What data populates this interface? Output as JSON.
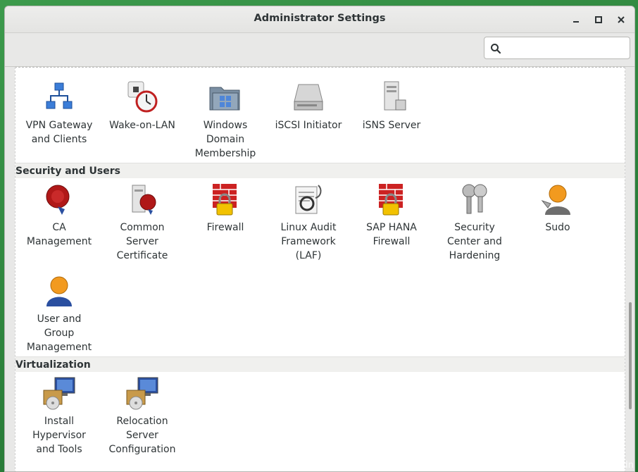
{
  "window": {
    "title": "Administrator Settings",
    "minimize_symbol": "–",
    "maximize_symbol": "□",
    "close_symbol": "✕"
  },
  "search": {
    "value": "",
    "placeholder": ""
  },
  "sections": {
    "network_items": [
      {
        "label": "VPN Gateway\nand Clients",
        "icon": "network-tree-icon"
      },
      {
        "label": "Wake-on-LAN",
        "icon": "wake-on-lan-icon"
      },
      {
        "label": "Windows\nDomain\nMembership",
        "icon": "windows-folder-icon"
      },
      {
        "label": "iSCSI Initiator",
        "icon": "disk-drive-icon"
      },
      {
        "label": "iSNS Server",
        "icon": "server-icon"
      }
    ],
    "security": {
      "title": "Security and Users",
      "items": [
        {
          "label": "CA\nManagement",
          "icon": "seal-icon"
        },
        {
          "label": "Common\nServer\nCertificate",
          "icon": "server-seal-icon"
        },
        {
          "label": "Firewall",
          "icon": "firewall-lock-icon"
        },
        {
          "label": "Linux Audit\nFramework\n(LAF)",
          "icon": "audit-icon"
        },
        {
          "label": "SAP HANA\nFirewall",
          "icon": "firewall-lock-icon"
        },
        {
          "label": "Security\nCenter and\nHardening",
          "icon": "keys-icon"
        },
        {
          "label": "Sudo",
          "icon": "sudo-user-icon"
        },
        {
          "label": "User and\nGroup\nManagement",
          "icon": "user-icon"
        }
      ]
    },
    "virtualization": {
      "title": "Virtualization",
      "items": [
        {
          "label": "Install\nHypervisor\nand Tools",
          "icon": "monitor-disc-icon"
        },
        {
          "label": "Relocation\nServer\nConfiguration",
          "icon": "monitor-disc-icon"
        }
      ]
    }
  },
  "watermark": "https://blog.csdn.net/qi512csdn",
  "colors": {
    "desktop_green": "#2e8b3e",
    "firewall_red": "#cc2222",
    "lock_yellow": "#f2c200",
    "seal_red": "#b01818",
    "user_orange": "#f29a1f"
  }
}
